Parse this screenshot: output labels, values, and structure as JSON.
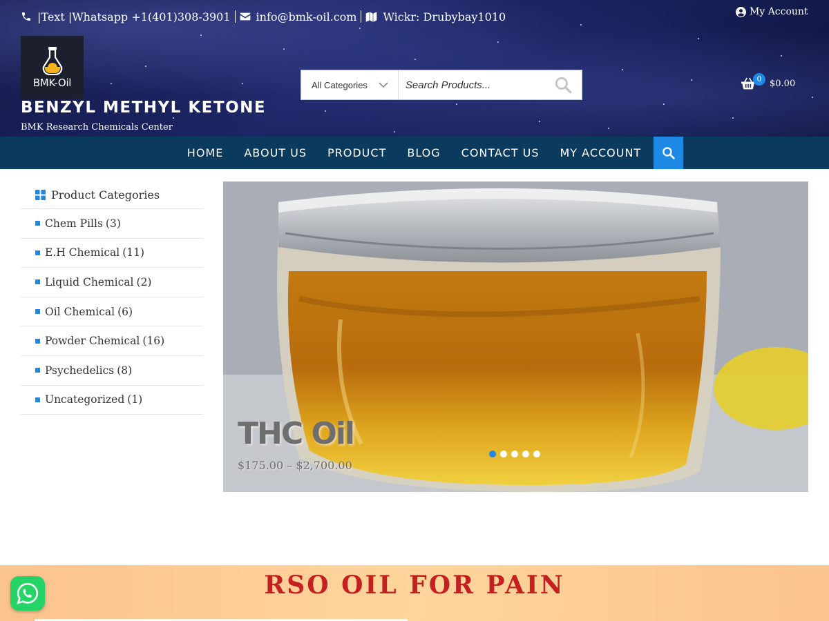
{
  "topbar": {
    "phone": "|Text |Whatsapp +1(401)308-3901",
    "email": "info@bmk-oil.com",
    "wickr": "Wickr: Drubybay1010",
    "my_account": "My Account"
  },
  "branding": {
    "logo_text": "BMK-Oil",
    "site_title": "BENZYL METHYL KETONE",
    "tagline": "BMK Research Chemicals Center"
  },
  "search": {
    "category_selected": "All Categories",
    "placeholder": "Search Products..."
  },
  "cart": {
    "count": "0",
    "total": "$0.00"
  },
  "nav": {
    "items": [
      "HOME",
      "ABOUT US",
      "PRODUCT",
      "BLOG",
      "CONTACT US",
      "MY ACCOUNT"
    ]
  },
  "sidebar": {
    "heading": "Product Categories",
    "categories": [
      {
        "label": "Chem Pills",
        "count": "(3)"
      },
      {
        "label": "E.H Chemical",
        "count": "(11)"
      },
      {
        "label": "Liquid Chemical",
        "count": "(2)"
      },
      {
        "label": "Oil Chemical",
        "count": "(6)"
      },
      {
        "label": "Powder Chemical",
        "count": "(16)"
      },
      {
        "label": "Psychedelics",
        "count": "(8)"
      },
      {
        "label": "Uncategorized",
        "count": "(1)"
      }
    ]
  },
  "slider": {
    "title": "THC Oil",
    "price": "$175.00 – $2,700.00",
    "slide_count": 5,
    "active_slide": 1
  },
  "promo": {
    "title": "RSO OIL FOR PAIN"
  },
  "colors": {
    "accent": "#1e88e5",
    "nav_bg": "#0b3a5f",
    "promo_title": "#c42020",
    "whatsapp": "#25d366"
  }
}
